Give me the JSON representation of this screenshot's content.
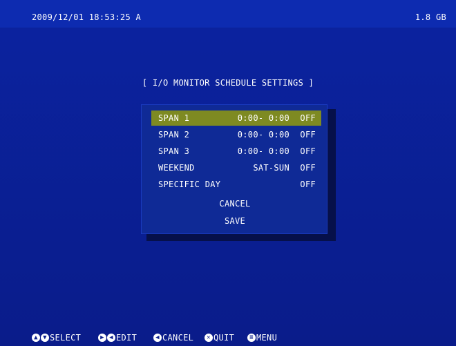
{
  "status_bar": {
    "datetime": "2009/12/01 18:53:25  A",
    "disk": "1.8 GB"
  },
  "dialog": {
    "title": "[ I/O MONITOR SCHEDULE SETTINGS ]",
    "rows": [
      {
        "label": "SPAN 1",
        "range": "0:00- 0:00",
        "state": "OFF"
      },
      {
        "label": "SPAN 2",
        "range": "0:00- 0:00",
        "state": "OFF"
      },
      {
        "label": "SPAN 3",
        "range": "0:00- 0:00",
        "state": "OFF"
      },
      {
        "label": "WEEKEND",
        "range": "SAT-SUN",
        "state": "OFF"
      },
      {
        "label": "SPECIFIC DAY",
        "range": "",
        "state": "OFF"
      }
    ],
    "cancel_label": "CANCEL",
    "save_label": "SAVE"
  },
  "footer": {
    "select": "SELECT",
    "edit": "EDIT",
    "cancel": "CANCEL",
    "quit": "QUIT",
    "menu": "MENU"
  },
  "colors": {
    "background": "#0a1e8c",
    "panel": "#0f2a96",
    "selection": "#7e8a22"
  },
  "icons": [
    "up-down-arrows-icon",
    "left-right-arrows-icon",
    "back-arrow-icon",
    "quit-icon",
    "menu-icon"
  ]
}
